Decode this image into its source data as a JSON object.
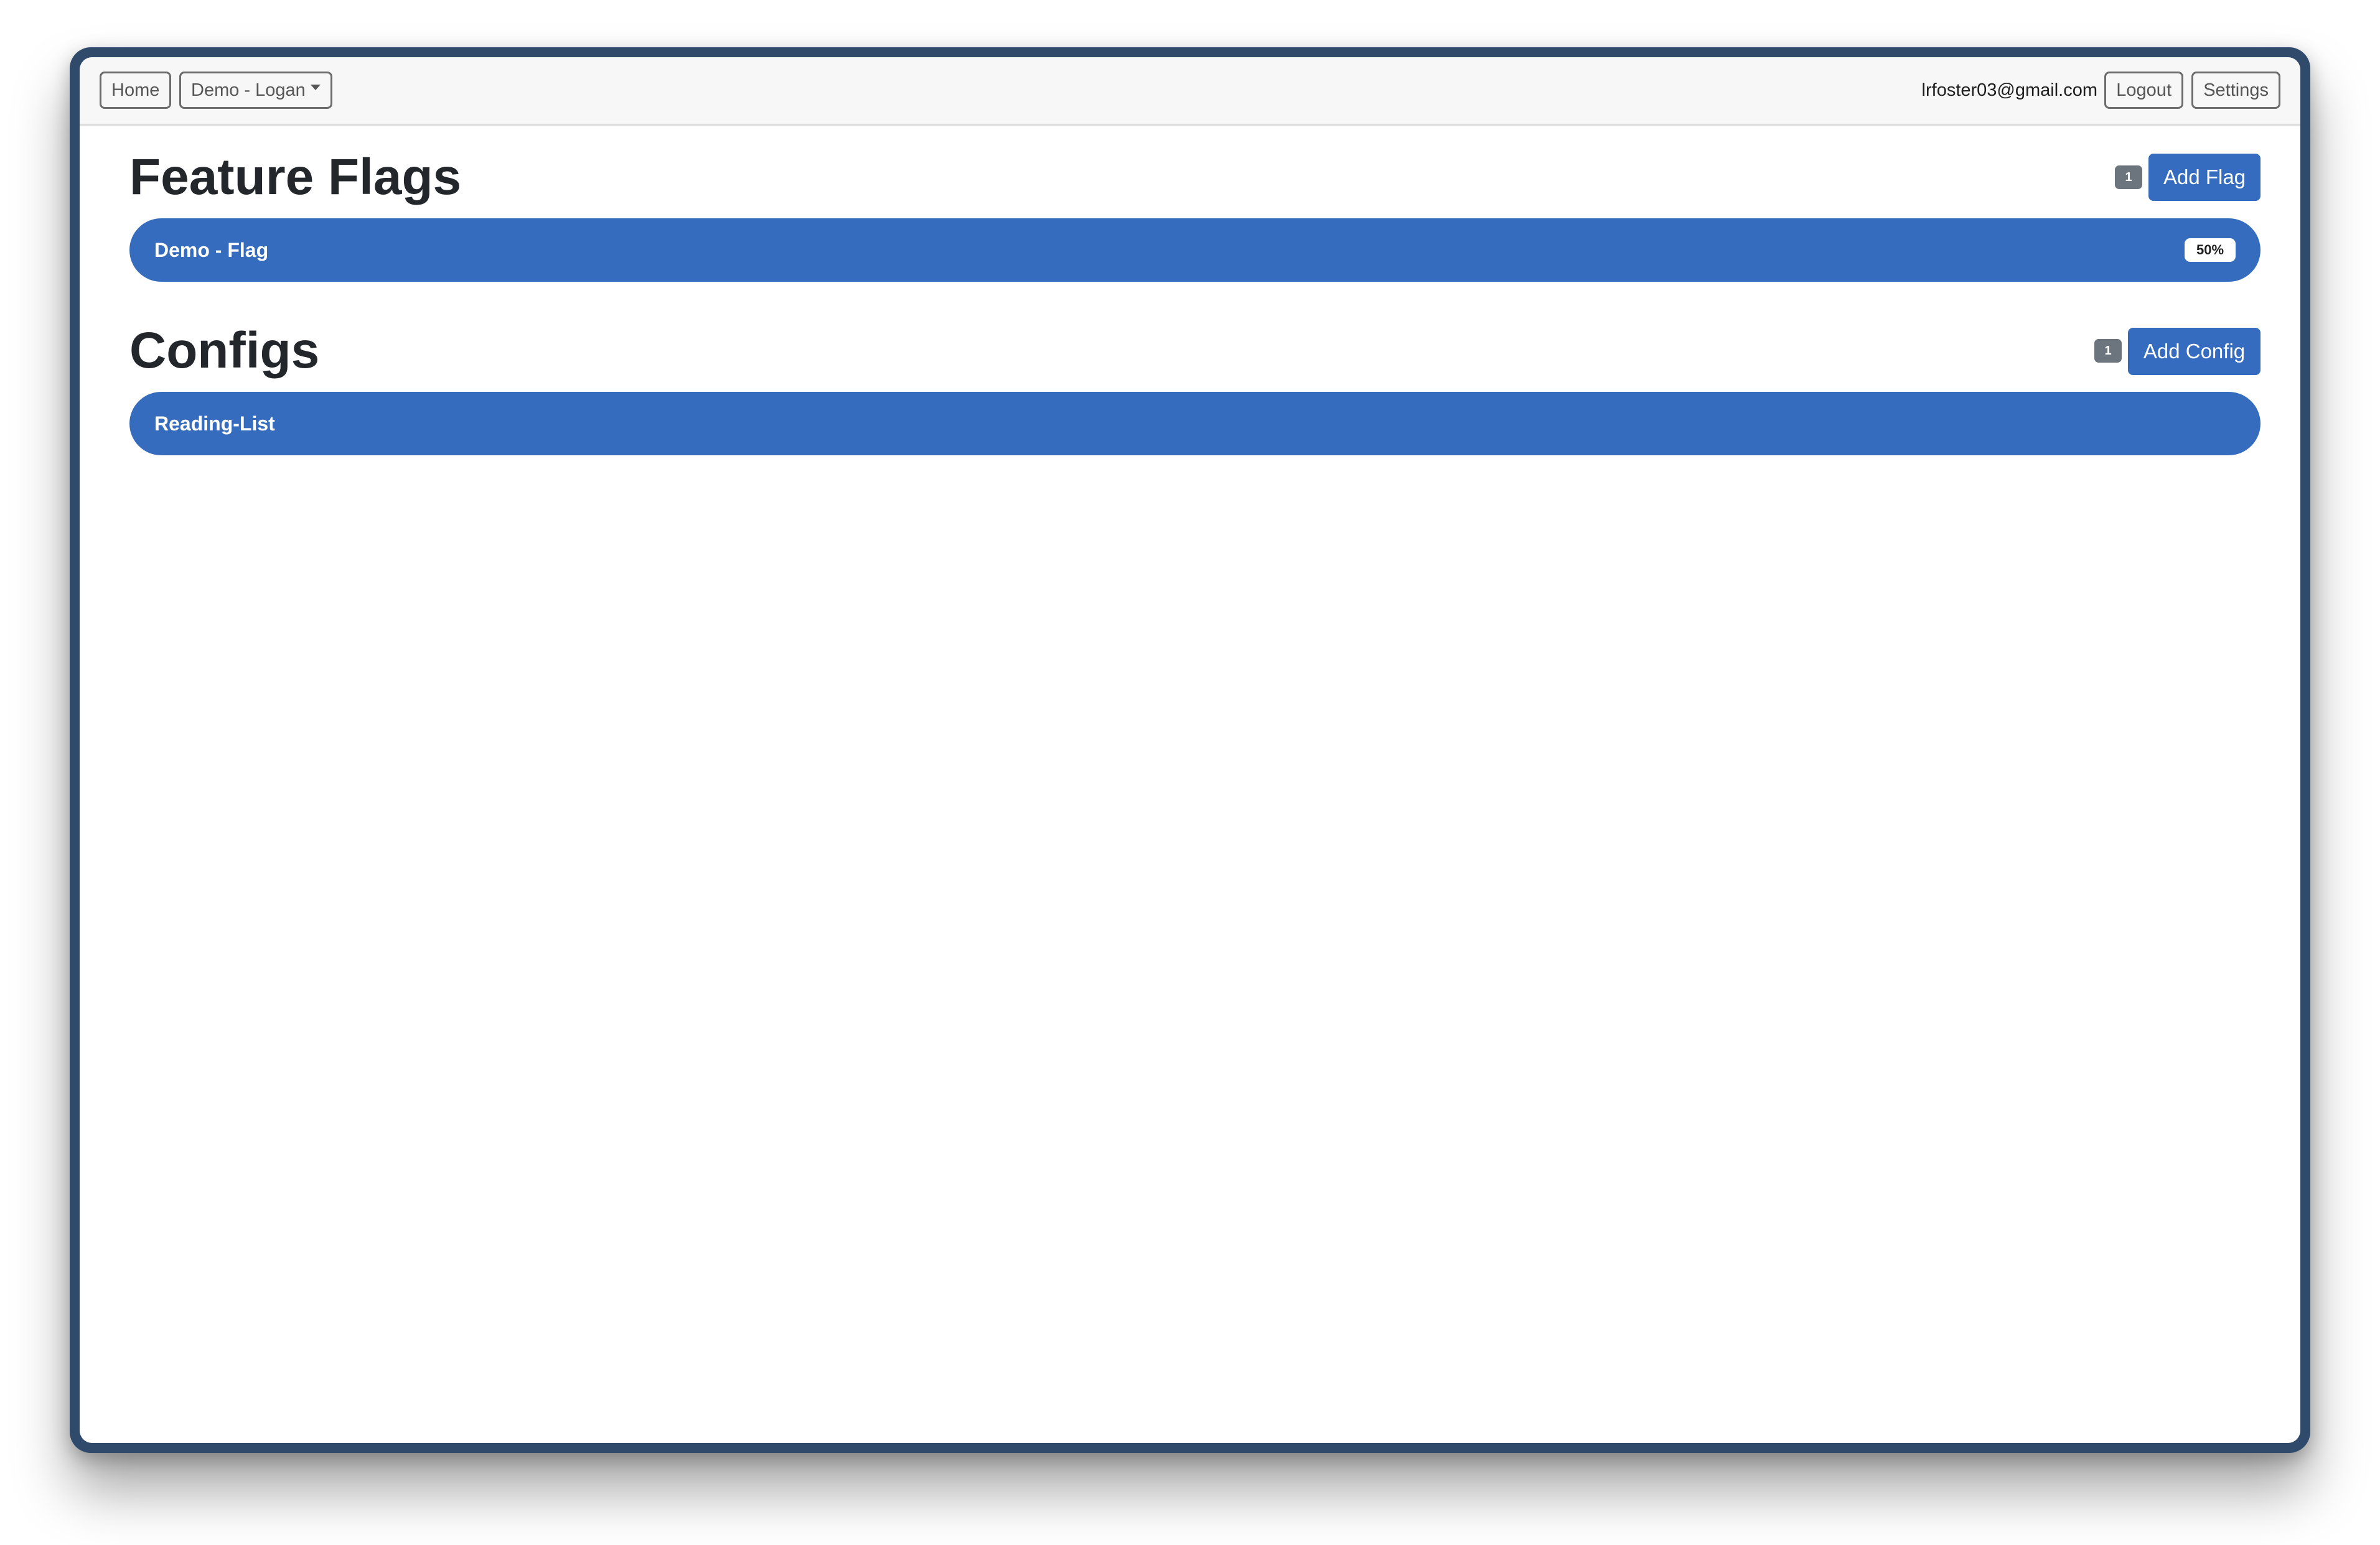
{
  "navbar": {
    "home_label": "Home",
    "project_dropdown_label": "Demo - Logan",
    "user_email": "lrfoster03@gmail.com",
    "logout_label": "Logout",
    "settings_label": "Settings"
  },
  "feature_flags": {
    "title": "Feature Flags",
    "count": "1",
    "add_label": "Add Flag",
    "items": [
      {
        "name": "Demo - Flag",
        "rollout": "50%"
      }
    ]
  },
  "configs": {
    "title": "Configs",
    "count": "1",
    "add_label": "Add Config",
    "items": [
      {
        "name": "Reading-List"
      }
    ]
  },
  "colors": {
    "primary": "#356cbf",
    "badge_gray": "#6c757d",
    "window_border": "#2f4a6b",
    "navbar_bg": "#f7f7f7"
  }
}
